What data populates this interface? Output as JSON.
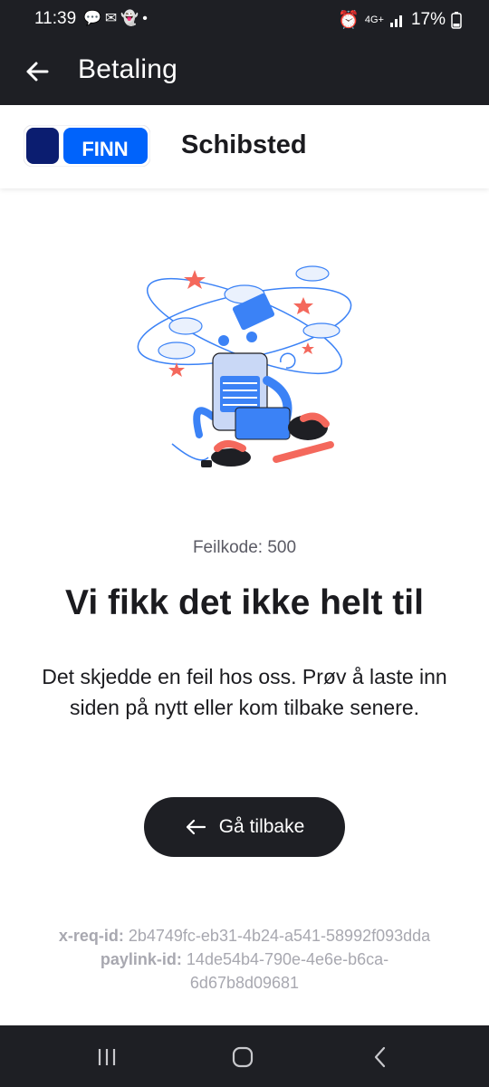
{
  "status_bar": {
    "time": "11:39",
    "network": "4G+",
    "battery": "17%",
    "left_icons": [
      "chat-icon",
      "mail-icon",
      "snapchat-icon",
      "dot-icon"
    ],
    "right_icons": [
      "alarm-icon",
      "signal-icon",
      "battery-icon"
    ]
  },
  "app_bar": {
    "title": "Betaling",
    "back_icon": "arrow-left-icon"
  },
  "merchant": {
    "logo_text": "FINN",
    "name": "Schibsted"
  },
  "error": {
    "code_label": "Feilkode: 500",
    "headline": "Vi fikk det ikke helt til",
    "message": "Det skjedde en feil hos oss. Prøv å laste inn siden på nytt eller kom tilbake senere."
  },
  "back_button": {
    "label": "Gå tilbake",
    "icon": "arrow-left-icon"
  },
  "ids": {
    "req_label": "x-req-id:",
    "req_value": "2b4749fc-eb31-4b24-a541-58992f093dda",
    "paylink_label": "paylink-id:",
    "paylink_value": "14de54b4-790e-4e6e-b6ca-6d67b8d09681"
  },
  "colors": {
    "dark": "#1e1f24",
    "finn_blue": "#0063fb",
    "finn_navy": "#06bffc",
    "accent_red": "#f4685c",
    "illustration_blue": "#3b82f6"
  }
}
